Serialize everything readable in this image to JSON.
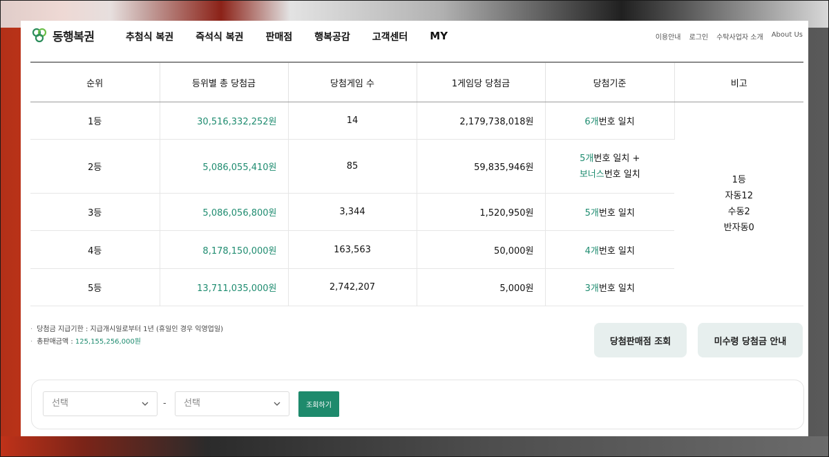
{
  "colors": {
    "accent": "#1f8c70",
    "button_bg": "#1e8a6c",
    "light_button_bg": "#e7efee"
  },
  "header": {
    "logo_text": "동행복권",
    "nav": [
      "추첨식 복권",
      "즉석식 복권",
      "판매점",
      "행복공감",
      "고객센터",
      "MY"
    ],
    "util": [
      "이용안내",
      "로그인",
      "수탁사업자 소개",
      "About Us"
    ]
  },
  "table": {
    "headers": [
      "순위",
      "등위별 총 당첨금",
      "당첨게임 수",
      "1게임당 당첨금",
      "당첨기준",
      "비고"
    ],
    "rows": [
      {
        "rank": "1등",
        "total": "30,516,332,252원",
        "games": "14",
        "per_game": "2,179,738,018원",
        "crit_n": "6개",
        "crit_t": "번호 일치"
      },
      {
        "rank": "2등",
        "total": "5,086,055,410원",
        "games": "85",
        "per_game": "59,835,946원",
        "crit_n": "5개",
        "crit_t": "번호 일치 +",
        "crit_b": "보너스",
        "crit_bt": "번호 일치"
      },
      {
        "rank": "3등",
        "total": "5,086,056,800원",
        "games": "3,344",
        "per_game": "1,520,950원",
        "crit_n": "5개",
        "crit_t": "번호 일치"
      },
      {
        "rank": "4등",
        "total": "8,178,150,000원",
        "games": "163,563",
        "per_game": "50,000원",
        "crit_n": "4개",
        "crit_t": "번호 일치"
      },
      {
        "rank": "5등",
        "total": "13,711,035,000원",
        "games": "2,742,207",
        "per_game": "5,000원",
        "crit_n": "3개",
        "crit_t": "번호 일치"
      }
    ],
    "remarks": [
      "1등",
      "자동12",
      "수동2",
      "반자동0"
    ]
  },
  "notes": {
    "deadline": "당첨금 지급기한 : 지급개시일로부터 1년 (휴일인 경우 익영업일)",
    "sales_label": "총판매금액 : ",
    "sales_amount": "125,155,256,000원"
  },
  "buttons": {
    "store_search": "당첨판매점 조회",
    "unclaimed": "미수령 당첨금 안내"
  },
  "search": {
    "select1": "선택",
    "dash": "-",
    "select2": "선택",
    "submit": "조회하기"
  }
}
